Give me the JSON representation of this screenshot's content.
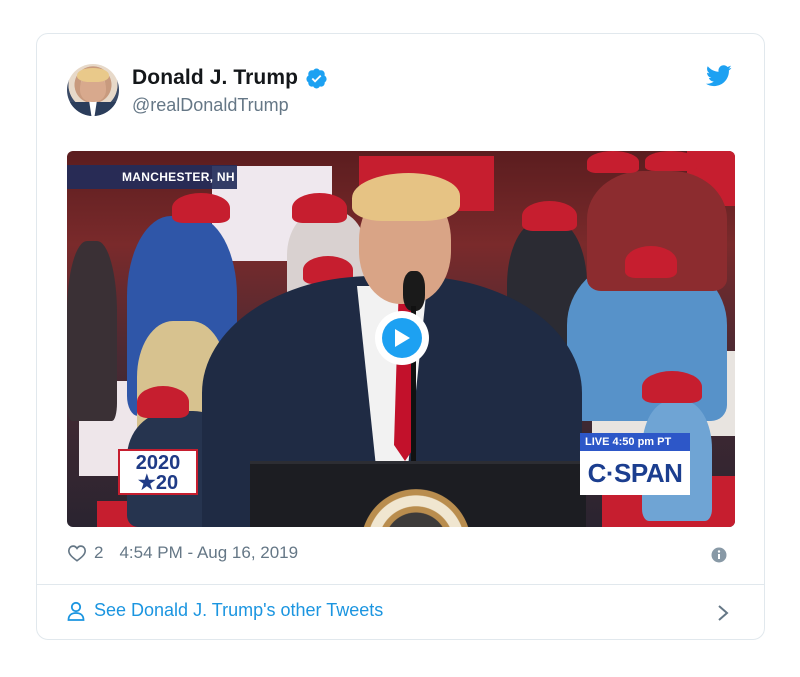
{
  "tweet": {
    "display_name": "Donald J. Trump",
    "handle": "@realDonaldTrump",
    "like_count": "2",
    "timestamp": "4:54 PM - Aug 16, 2019",
    "other_tweets_label": "See Donald J. Trump's other Tweets"
  },
  "video": {
    "location_tag": "MANCHESTER, NH",
    "live_label": "LIVE 4:50 pm PT",
    "network_logo": "C·SPAN",
    "campaign_logo_line1": "2020",
    "campaign_logo_line2": "★20"
  },
  "colors": {
    "twitter_blue": "#1da1f2",
    "link_blue": "#1b95e0",
    "text_secondary": "#657786",
    "border": "#e1e8ed"
  },
  "icons": {
    "verified": "verified-badge-icon",
    "brand": "twitter-bird-icon",
    "like": "heart-icon",
    "info": "info-icon",
    "profile": "person-icon",
    "chevron": "chevron-right-icon",
    "play": "play-icon"
  }
}
